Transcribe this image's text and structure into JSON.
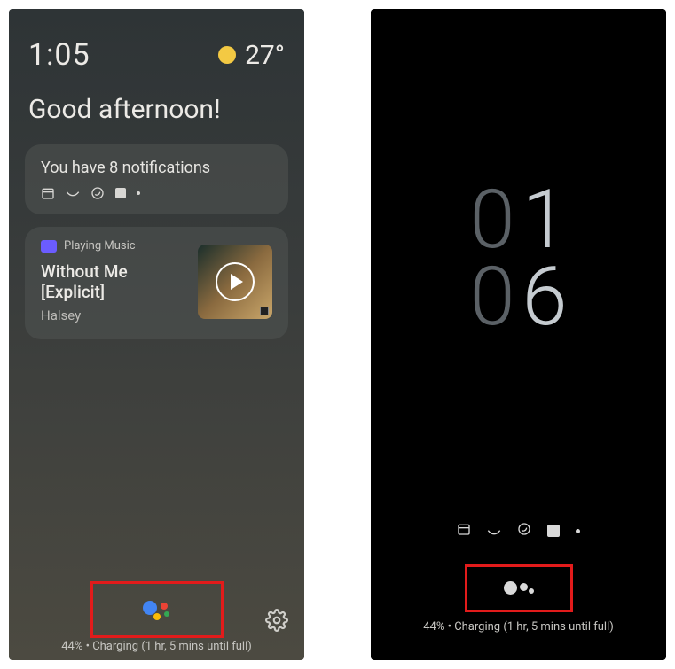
{
  "left": {
    "time": "1:05",
    "temperature": "27°",
    "greeting": "Good afternoon!",
    "notifications": {
      "title": "You have 8 notifications"
    },
    "music": {
      "source": "Playing Music",
      "title": "Without Me [Explicit]",
      "artist": "Halsey"
    },
    "charging": "44% • Charging (1 hr, 5 mins until full)"
  },
  "right": {
    "clock": {
      "h1": "0",
      "h2": "1",
      "m1": "0",
      "m2": "6"
    },
    "charging": "44% • Charging (1 hr, 5 mins until full)"
  }
}
